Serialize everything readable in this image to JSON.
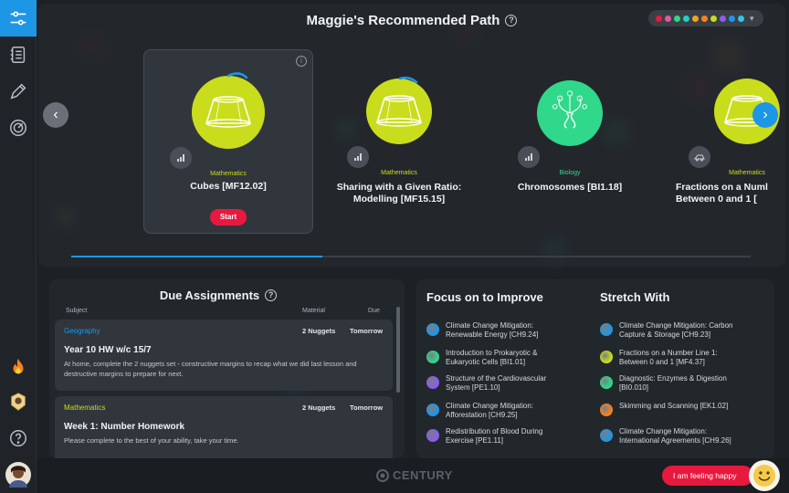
{
  "sidebar": {
    "items": [
      {
        "name": "sidebar-item-path",
        "icon": "sliders-icon",
        "active": true
      },
      {
        "name": "sidebar-item-notes",
        "icon": "notebook-icon"
      },
      {
        "name": "sidebar-item-edit",
        "icon": "pencil-icon"
      },
      {
        "name": "sidebar-item-dashboard",
        "icon": "gauge-icon"
      },
      {
        "name": "sidebar-item-streak",
        "icon": "flame-icon"
      },
      {
        "name": "sidebar-item-badge",
        "icon": "badge-icon"
      },
      {
        "name": "sidebar-item-help",
        "icon": "help-icon"
      },
      {
        "name": "sidebar-item-profile",
        "icon": "avatar-icon"
      }
    ]
  },
  "path": {
    "title": "Maggie's Recommended Path",
    "help": "?",
    "theme_colors": [
      "#e8193f",
      "#e05aa0",
      "#2fd88a",
      "#1fd0c8",
      "#f1a51c",
      "#f58220",
      "#c9dd1c",
      "#8a5cf0",
      "#1e96e6",
      "#2fc6e8"
    ],
    "progress": 0.37,
    "courses": [
      {
        "subject": "Mathematics",
        "name": "Cubes [MF12.02]",
        "start_label": "Start",
        "info": "i",
        "kind": "math"
      },
      {
        "subject": "Mathematics",
        "name": "Sharing with a Given Ratio:\nModelling [MF15.15]",
        "kind": "math"
      },
      {
        "subject": "Biology",
        "name": "Chromosomes [BI1.18]",
        "kind": "bio"
      },
      {
        "subject": "Mathematics",
        "name": "Fractions on a Numl\nBetween 0 and 1 [",
        "kind": "math"
      }
    ]
  },
  "due": {
    "title": "Due Assignments",
    "help": "?",
    "headers": {
      "subject": "Subject",
      "material": "Material",
      "due": "Due"
    },
    "assignments": [
      {
        "subject": "Geography",
        "material": "2 Nuggets",
        "due": "Tomorrow",
        "name": "Year 10 HW w/c 15/7",
        "description": "At home, complete the 2 nuggets set - constructive margins to recap what we did last lesson and destructive margins to prepare for next."
      },
      {
        "subject": "Mathematics",
        "material": "2 Nuggets",
        "due": "Tomorrow",
        "name": "Week 1: Number Homework",
        "description": "Please complete to the best of your ability, take your time."
      }
    ]
  },
  "focus": {
    "title": "Focus on to Improve",
    "items": [
      {
        "text": "Climate Change Mitigation:\nRenewable Energy [CH9.24]",
        "color": "#1e96e6"
      },
      {
        "text": "Introduction to Prokaryotic &\nEukaryotic Cells [BI1.01]",
        "color": "#2fd88a"
      },
      {
        "text": "Structure of the Cardiovascular\nSystem [PE1.10]",
        "color": "#8a5cf0"
      },
      {
        "text": "Climate Change Mitigation:\nAfforestation [CH9.25]",
        "color": "#1e96e6"
      },
      {
        "text": "Redistribution of Blood During\nExercise [PE1.11]",
        "color": "#8a5cf0"
      }
    ]
  },
  "stretch": {
    "title": "Stretch With",
    "items": [
      {
        "text": "Climate Change Mitigation: Carbon\nCapture & Storage [CH9.23]",
        "color": "#1e96e6"
      },
      {
        "text": "Fractions on a Number Line 1:\nBetween 0 and 1 [MF4.37]",
        "color": "#c9dd1c"
      },
      {
        "text": "Diagnostic: Enzymes & Digestion\n[BI0.010]",
        "color": "#2fd88a"
      },
      {
        "text": "Skimming and Scanning [EK1.02]",
        "color": "#f58220"
      },
      {
        "text": "Climate Change Mitigation:\nInternational Agreements [CH9.26]",
        "color": "#1e96e6"
      }
    ]
  },
  "footer": {
    "brand": "CENTURY",
    "mood_label": "I am feeling happy"
  }
}
